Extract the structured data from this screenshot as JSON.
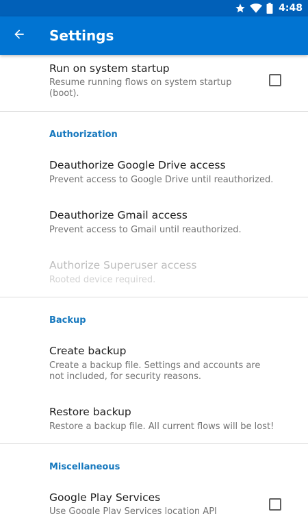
{
  "status_bar": {
    "time": "4:48",
    "icons": [
      "star-icon",
      "wifi-icon",
      "battery-icon"
    ]
  },
  "app_bar": {
    "title": "Settings",
    "back_icon": "arrow-back-icon"
  },
  "preferences": {
    "run_on_startup": {
      "title": "Run on system startup",
      "summary": "Resume running flows on system startup (boot).",
      "checked": false
    },
    "authorization": {
      "header": "Authorization",
      "drive": {
        "title": "Deauthorize Google Drive access",
        "summary": "Prevent access to Google Drive until reauthorized."
      },
      "gmail": {
        "title": "Deauthorize Gmail access",
        "summary": "Prevent access to Gmail until reauthorized."
      },
      "superuser": {
        "title": "Authorize Superuser access",
        "summary": "Rooted device required.",
        "enabled": false
      }
    },
    "backup": {
      "header": "Backup",
      "create": {
        "title": "Create backup",
        "summary": "Create a backup file. Settings and accounts are not included, for security reasons."
      },
      "restore": {
        "title": "Restore backup",
        "summary": "Restore a backup file. All current flows will be lost!"
      }
    },
    "misc": {
      "header": "Miscellaneous",
      "play_services": {
        "title": "Google Play Services",
        "summary": "Use Google Play Services location API",
        "checked": false
      }
    }
  },
  "colors": {
    "status_bar": "#0160b8",
    "app_bar": "#0174d2",
    "accent": "#1678be"
  }
}
